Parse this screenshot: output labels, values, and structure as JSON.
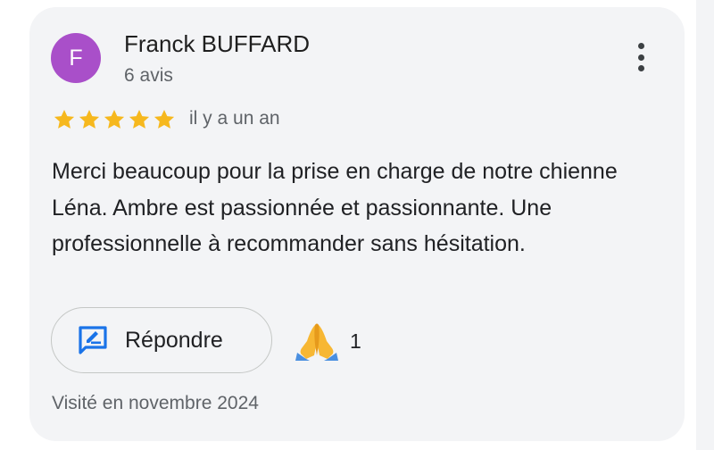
{
  "reviewer": {
    "initial": "F",
    "name": "Franck BUFFARD",
    "review_count": "6 avis",
    "avatar_color": "#a94fc9"
  },
  "rating": {
    "stars": 5,
    "max": 5,
    "star_color": "#f6b81e"
  },
  "time_ago": "il y a un an",
  "review_text": "Merci beaucoup pour la prise en charge de notre chienne Léna. Ambre est passionnée et passionnante. Une professionnelle à recommander sans hésitation.",
  "actions": {
    "reply_label": "Répondre",
    "reaction_icon": "folded-hands-emoji",
    "reaction_count": "1",
    "more_icon": "more-vertical-icon",
    "reply_icon": "edit-reply-icon"
  },
  "visit": "Visité en novembre 2024",
  "colors": {
    "accent": "#1a73e8",
    "card_bg": "#f3f4f6"
  }
}
